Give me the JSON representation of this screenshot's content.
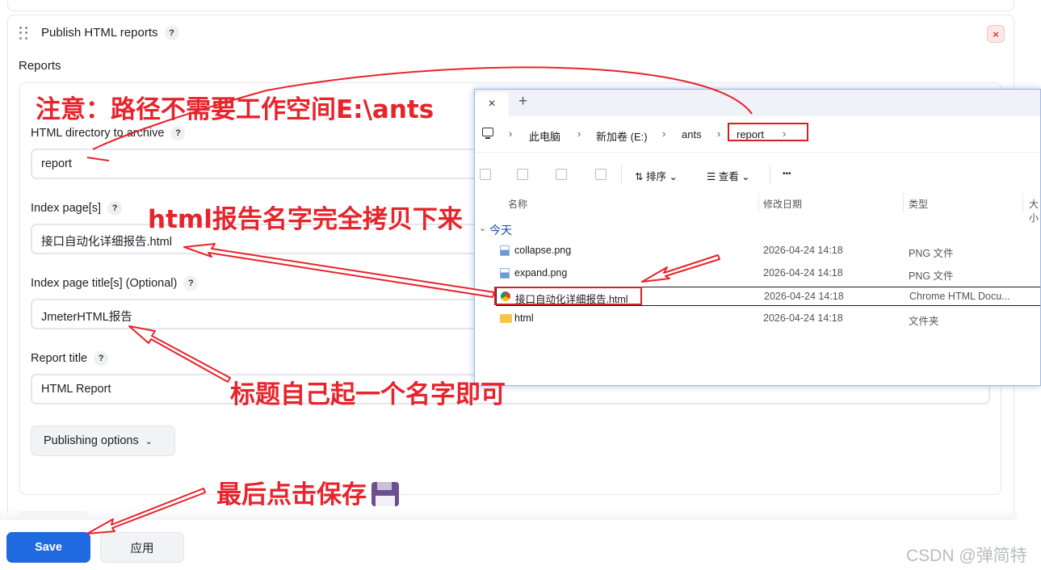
{
  "step": {
    "title": "Publish HTML reports",
    "help": "?",
    "close": "×"
  },
  "reports": {
    "label": "Reports",
    "fields": [
      {
        "label": "HTML directory to archive",
        "value": "report"
      },
      {
        "label": "Index page[s]",
        "value": "接口自动化详细报告.html"
      },
      {
        "label": "Index page title[s] (Optional)",
        "value": "JmeterHTML报告"
      },
      {
        "label": "Report title",
        "value": "HTML Report"
      }
    ],
    "publishing_options": "Publishing options"
  },
  "actions": {
    "save": "Save",
    "apply": "应用"
  },
  "watermark": "CSDN @弹简特",
  "explorer": {
    "tab_close": "×",
    "new_tab": "+",
    "breadcrumb": [
      "此电脑",
      "新加卷 (E:)",
      "ants",
      "report"
    ],
    "toolbar": {
      "sort": "排序",
      "view": "查看",
      "more": "•••"
    },
    "columns": {
      "name": "名称",
      "modified": "修改日期",
      "type": "类型",
      "size": "大小"
    },
    "group": "今天",
    "files": [
      {
        "name": "collapse.png",
        "modified": "2026-04-24 14:18",
        "type": "PNG 文件",
        "icon": "image-file-icon"
      },
      {
        "name": "expand.png",
        "modified": "2026-04-24 14:18",
        "type": "PNG 文件",
        "icon": "image-file-icon"
      },
      {
        "name": "接口自动化详细报告.html",
        "modified": "2026-04-24 14:18",
        "type": "Chrome HTML Docu...",
        "icon": "chrome-html-icon"
      },
      {
        "name": "html",
        "modified": "2026-04-24 14:18",
        "type": "文件夹",
        "icon": "folder-icon"
      }
    ]
  },
  "annotations": {
    "path_note": "注意：路径不需要工作空间E:\\ants",
    "copy_note": "html报告名字完全拷贝下来",
    "title_note": "标题自己起一个名字即可",
    "save_note": "最后点击保存"
  },
  "colors": {
    "annotation_red": "#e8232b",
    "save_blue": "#1f6ae0",
    "explorer_group_blue": "#1a4dab"
  }
}
